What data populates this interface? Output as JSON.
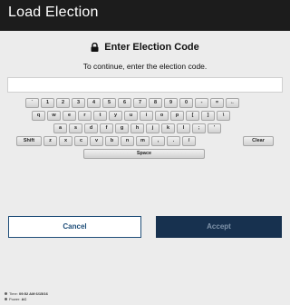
{
  "window": {
    "title": "Load Election"
  },
  "dialog": {
    "heading": "Enter Election Code",
    "subtitle": "To continue, enter the election code.",
    "code_value": ""
  },
  "keyboard": {
    "rows": [
      [
        "`",
        "1",
        "2",
        "3",
        "4",
        "5",
        "6",
        "7",
        "8",
        "9",
        "0",
        "-",
        "=",
        "←"
      ],
      [
        "q",
        "w",
        "e",
        "r",
        "t",
        "y",
        "u",
        "i",
        "o",
        "p",
        "[",
        "]",
        "\\"
      ],
      [
        "a",
        "s",
        "d",
        "f",
        "g",
        "h",
        "j",
        "k",
        "l",
        ";",
        "'"
      ],
      [
        "Shift",
        "z",
        "x",
        "c",
        "v",
        "b",
        "n",
        "m",
        ",",
        ".",
        "/",
        "Clear"
      ],
      [
        "Space"
      ]
    ]
  },
  "buttons": {
    "cancel": "Cancel",
    "accept": "Accept"
  },
  "status": {
    "time_label": "Time:",
    "time_value": "09:52 AM 6/15/16",
    "power_label": "Power:",
    "power_value": "AC"
  },
  "colors": {
    "titlebar": "#1c1c1c",
    "accent": "#1f4e79",
    "accept_bg": "#17314f"
  }
}
